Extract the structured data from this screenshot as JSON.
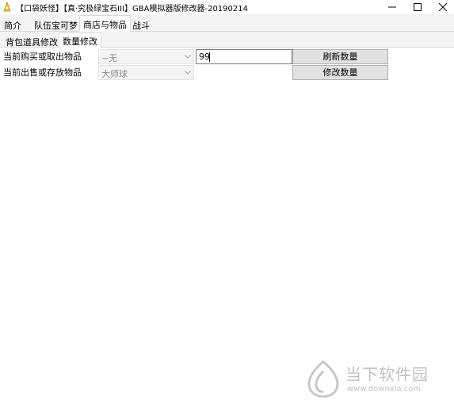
{
  "window": {
    "title": "【口袋妖怪】【真·究极绿宝石III】GBA模拟器版修改器-20190214"
  },
  "main_tabs": [
    {
      "label": "简介",
      "active": false
    },
    {
      "label": "队伍宝可梦",
      "active": false
    },
    {
      "label": "商店与物品",
      "active": true
    },
    {
      "label": "战斗",
      "active": false
    }
  ],
  "sub_tabs": [
    {
      "label": "背包道具修改",
      "active": false
    },
    {
      "label": "数量修改",
      "active": true
    }
  ],
  "form": {
    "buy_label": "当前购买或取出物品",
    "buy_value": "~无",
    "quantity_value": "99",
    "refresh_label": "刷新数量",
    "sell_label": "当前出售或存放物品",
    "sell_value": "大师球",
    "modify_label": "修改数量"
  },
  "watermark": {
    "name": "当下软件园",
    "url": "www.downxia.com"
  },
  "icons": {
    "app": "app-icon",
    "minimize": "minimize-icon",
    "maximize": "maximize-icon",
    "close": "close-icon",
    "dropdown": "chevron-down-icon"
  }
}
